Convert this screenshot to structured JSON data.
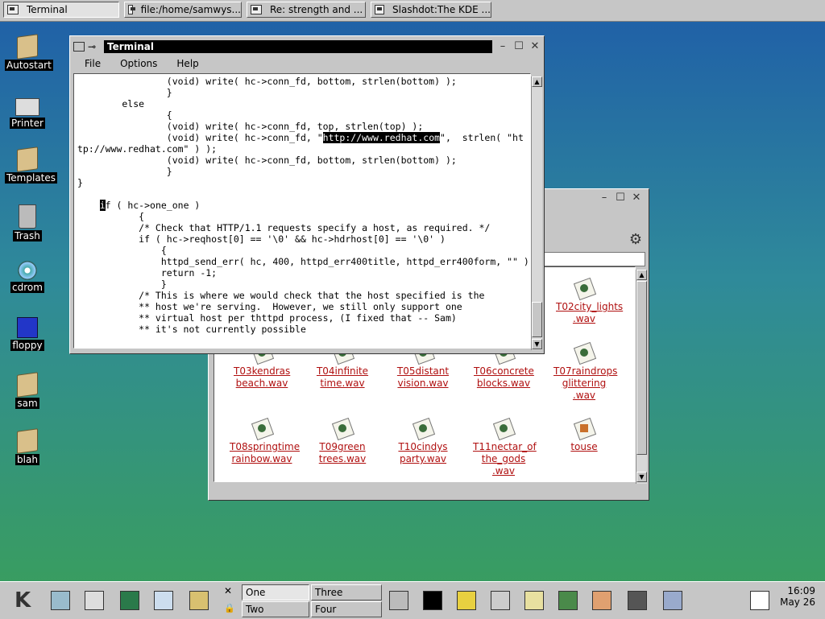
{
  "taskbar": {
    "tasks": [
      {
        "label": "Terminal"
      },
      {
        "label": "file:/home/samwys..."
      },
      {
        "label": "Re: strength and ..."
      },
      {
        "label": "Slashdot:The KDE ..."
      }
    ]
  },
  "desktop": {
    "icons": [
      {
        "label": "Autostart",
        "icon": "folder-icon"
      },
      {
        "label": "Printer",
        "icon": "printer-icon"
      },
      {
        "label": "Templates",
        "icon": "folder-icon"
      },
      {
        "label": "Trash",
        "icon": "trash-icon"
      },
      {
        "label": "cdrom",
        "icon": "cdrom-icon"
      },
      {
        "label": "floppy",
        "icon": "floppy-icon"
      },
      {
        "label": "sam",
        "icon": "folder-icon"
      },
      {
        "label": "blah",
        "icon": "folder-icon"
      }
    ]
  },
  "terminal": {
    "title": "Terminal",
    "menu": [
      "File",
      "Options",
      "Help"
    ],
    "lines": [
      "                (void) write( hc->conn_fd, bottom, strlen(bottom) );",
      "                }",
      "        else",
      "                {",
      "                (void) write( hc->conn_fd, top, strlen(top) );",
      "                (void) write( hc->conn_fd, \"",
      "tp://www.redhat.com\" ) );",
      "                (void) write( hc->conn_fd, bottom, strlen(bottom) );",
      "                }",
      "}",
      "",
      "",
      "           {",
      "           /* Check that HTTP/1.1 requests specify a host, as required. */",
      "           if ( hc->reqhost[0] == '\\0' && hc->hdrhost[0] == '\\0' )",
      "               {",
      "               httpd_send_err( hc, 400, httpd_err400title, httpd_err400form, \"\" );",
      "               return -1;",
      "               }",
      "           /* This is where we would check that the host specified is the",
      "           ** host we're serving.  However, we still only support one",
      "           ** virtual host per thttpd process, (I fixed that -- Sam)",
      "           ** it's not currently possible"
    ],
    "selected_text": "http://www.redhat.com",
    "line6_tail": "\",  strlen( \"ht",
    "cursor_char": "i",
    "line11_rest": "f ( hc->one_one )",
    "line11_indent": "    "
  },
  "file_manager": {
    "files": [
      {
        "label": "T02city_lights .wav"
      },
      {
        "label": "T03kendras beach.wav"
      },
      {
        "label": "T04infinite time.wav"
      },
      {
        "label": "T05distant vision.wav"
      },
      {
        "label": "T06concrete blocks.wav"
      },
      {
        "label": "T07raindrops glittering .wav"
      },
      {
        "label": "T08springtime rainbow.wav"
      },
      {
        "label": "T09green trees.wav"
      },
      {
        "label": "T10cindys party.wav"
      },
      {
        "label": "T11nectar_of the_gods .wav"
      },
      {
        "label": "touse"
      }
    ]
  },
  "panel": {
    "desktops": [
      "One",
      "Two",
      "Three",
      "Four"
    ],
    "time": "16:09",
    "date": "May 26"
  },
  "colors": {
    "link": "#b01010",
    "window_bg": "#c6c6c6"
  }
}
